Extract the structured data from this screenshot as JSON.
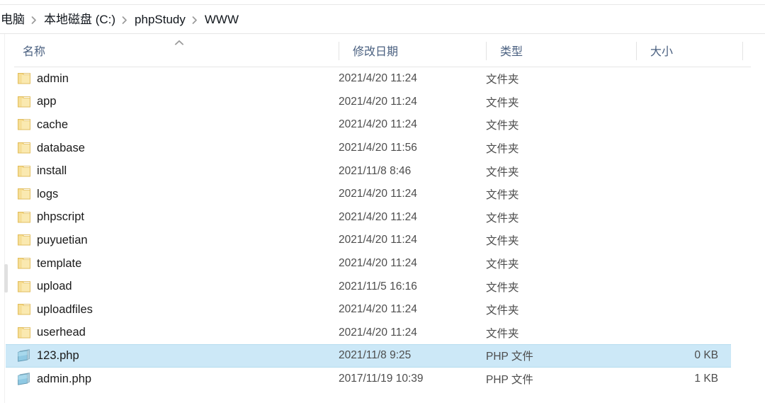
{
  "window": {
    "app": "file-explorer"
  },
  "breadcrumb": {
    "separator": "›",
    "items": [
      {
        "label": "电脑"
      },
      {
        "label": "本地磁盘 (C:)"
      },
      {
        "label": "phpStudy"
      },
      {
        "label": "WWW"
      }
    ]
  },
  "columns": {
    "name": "名称",
    "date_modified": "修改日期",
    "type": "类型",
    "size": "大小",
    "sort_indicator": "ascending"
  },
  "colors": {
    "selection_bg": "#cce8f7",
    "selection_border": "#b4dcef",
    "header_text": "#4a6080",
    "folder_icon": "#f5d57a",
    "php_icon": "#7fc4e0"
  },
  "files": [
    {
      "icon": "folder-icon",
      "name": "admin",
      "date": "2021/4/20 11:24",
      "type": "文件夹",
      "size": "",
      "selected": false
    },
    {
      "icon": "folder-icon",
      "name": "app",
      "date": "2021/4/20 11:24",
      "type": "文件夹",
      "size": "",
      "selected": false
    },
    {
      "icon": "folder-icon",
      "name": "cache",
      "date": "2021/4/20 11:24",
      "type": "文件夹",
      "size": "",
      "selected": false
    },
    {
      "icon": "folder-icon",
      "name": "database",
      "date": "2021/4/20 11:56",
      "type": "文件夹",
      "size": "",
      "selected": false
    },
    {
      "icon": "folder-icon",
      "name": "install",
      "date": "2021/11/8 8:46",
      "type": "文件夹",
      "size": "",
      "selected": false
    },
    {
      "icon": "folder-icon",
      "name": "logs",
      "date": "2021/4/20 11:24",
      "type": "文件夹",
      "size": "",
      "selected": false
    },
    {
      "icon": "folder-icon",
      "name": "phpscript",
      "date": "2021/4/20 11:24",
      "type": "文件夹",
      "size": "",
      "selected": false
    },
    {
      "icon": "folder-icon",
      "name": "puyuetian",
      "date": "2021/4/20 11:24",
      "type": "文件夹",
      "size": "",
      "selected": false
    },
    {
      "icon": "folder-icon",
      "name": "template",
      "date": "2021/4/20 11:24",
      "type": "文件夹",
      "size": "",
      "selected": false
    },
    {
      "icon": "folder-icon",
      "name": "upload",
      "date": "2021/11/5 16:16",
      "type": "文件夹",
      "size": "",
      "selected": false
    },
    {
      "icon": "folder-icon",
      "name": "uploadfiles",
      "date": "2021/4/20 11:24",
      "type": "文件夹",
      "size": "",
      "selected": false
    },
    {
      "icon": "folder-icon",
      "name": "userhead",
      "date": "2021/4/20 11:24",
      "type": "文件夹",
      "size": "",
      "selected": false
    },
    {
      "icon": "php-file-icon",
      "name": "123.php",
      "date": "2021/11/8 9:25",
      "type": "PHP 文件",
      "size": "0 KB",
      "selected": true
    },
    {
      "icon": "php-file-icon",
      "name": "admin.php",
      "date": "2017/11/19 10:39",
      "type": "PHP 文件",
      "size": "1 KB",
      "selected": false
    }
  ]
}
